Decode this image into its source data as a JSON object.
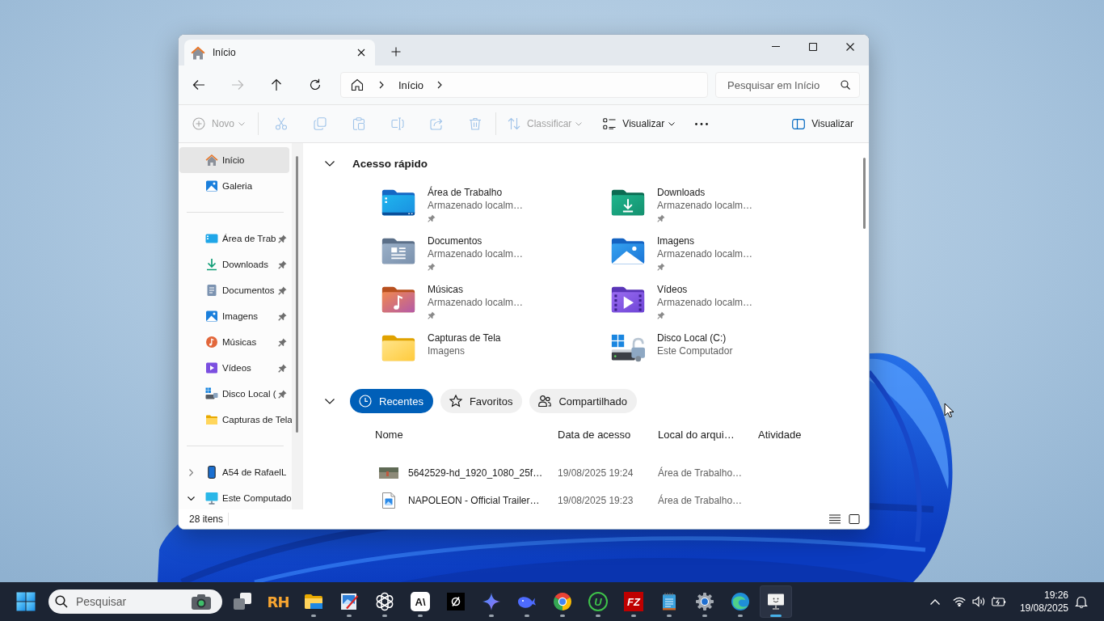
{
  "window": {
    "tabs": [
      {
        "label": "Início",
        "selected": true
      }
    ]
  },
  "navigation": {
    "buttons": [
      {
        "disabled": false
      },
      {
        "disabled": true
      },
      {
        "disabled": false
      },
      {
        "disabled": false
      }
    ],
    "breadcrumbs": [
      "Início"
    ]
  },
  "search": {
    "placeholder": "Pesquisar em Início"
  },
  "command_bar": {
    "new": {
      "label": "Novo",
      "disabled": true
    },
    "actions": [
      {
        "disabled": true
      },
      {
        "disabled": true
      },
      {
        "disabled": true
      },
      {
        "disabled": true
      },
      {
        "disabled": true
      },
      {
        "disabled": true
      }
    ],
    "sort": {
      "label": "Classificar",
      "disabled": true
    },
    "view": {
      "label": "Visualizar",
      "disabled": false
    },
    "details_pane": {
      "label": "Visualizar"
    }
  },
  "sidebar": {
    "sections": [
      {
        "items": [
          {
            "label": "Início",
            "selected": true
          },
          {
            "label": "Galeria",
            "selected": false
          }
        ]
      },
      {
        "items": [
          {
            "label": "Área de Trab",
            "selected": false,
            "pinned": true
          },
          {
            "label": "Downloads",
            "selected": false,
            "pinned": true
          },
          {
            "label": "Documentos",
            "selected": false,
            "pinned": true
          },
          {
            "label": "Imagens",
            "selected": false,
            "pinned": true
          },
          {
            "label": "Músicas",
            "selected": false,
            "pinned": true
          },
          {
            "label": "Vídeos",
            "selected": false,
            "pinned": true
          },
          {
            "label": "Disco Local (",
            "selected": false,
            "pinned": true
          },
          {
            "label": "Capturas de Tela",
            "selected": false,
            "pinned": false
          }
        ]
      },
      {
        "items": [
          {
            "label": "A54 de RafaelL",
            "selected": false,
            "expanded": false
          },
          {
            "label": "Este Computado",
            "selected": false,
            "expanded": true
          }
        ]
      }
    ]
  },
  "quick_access": {
    "title": "Acesso rápido",
    "expanded": true,
    "items": [
      {
        "name": "Área de Trabalho",
        "detail": "Armazenado localm…",
        "pinned": true
      },
      {
        "name": "Downloads",
        "detail": "Armazenado localm…",
        "pinned": true
      },
      {
        "name": "Documentos",
        "detail": "Armazenado localm…",
        "pinned": true
      },
      {
        "name": "Imagens",
        "detail": "Armazenado localm…",
        "pinned": true
      },
      {
        "name": "Músicas",
        "detail": "Armazenado localm…",
        "pinned": true
      },
      {
        "name": "Vídeos",
        "detail": "Armazenado localm…",
        "pinned": true
      },
      {
        "name": "Capturas de Tela",
        "detail": "Imagens",
        "pinned": false
      },
      {
        "name": "Disco Local (C:)",
        "detail": "Este Computador",
        "pinned": false
      }
    ]
  },
  "recent": {
    "expanded": true,
    "filters": [
      {
        "label": "Recentes",
        "selected": true
      },
      {
        "label": "Favoritos",
        "selected": false
      },
      {
        "label": "Compartilhado",
        "selected": false
      }
    ],
    "columns": [
      "Nome",
      "Data de acesso",
      "Local do arqui…",
      "Atividade"
    ],
    "rows": [
      {
        "kind": "video",
        "name": "5642529-hd_1920_1080_25f…",
        "accessed": "19/08/2025 19:24",
        "location": "Área de Trabalho…"
      },
      {
        "kind": "image",
        "name": "NAPOLEON - Official Trailer…",
        "accessed": "19/08/2025 19:23",
        "location": "Área de Trabalho…"
      }
    ]
  },
  "status_bar": {
    "item_count": "28 itens"
  },
  "taskbar": {
    "search": {
      "placeholder": "Pesquisar"
    },
    "apps": [
      {
        "label": "RH",
        "running": false,
        "selected": false
      },
      {
        "running": true,
        "selected": false
      },
      {
        "running": true,
        "selected": false
      },
      {
        "running": true,
        "selected": false
      },
      {
        "label": "A\\",
        "running": true,
        "selected": false
      },
      {
        "running": false,
        "selected": false
      },
      {
        "running": true,
        "selected": false
      },
      {
        "running": true,
        "selected": false
      },
      {
        "running": true,
        "selected": false
      },
      {
        "label": "U",
        "running": true,
        "selected": false
      },
      {
        "label": "FZ",
        "running": true,
        "selected": false
      },
      {
        "running": true,
        "selected": false
      },
      {
        "running": true,
        "selected": false
      },
      {
        "running": true,
        "selected": false
      },
      {
        "running": true,
        "selected": true
      }
    ],
    "clock": {
      "time": "19:26",
      "date": "19/08/2025"
    }
  }
}
